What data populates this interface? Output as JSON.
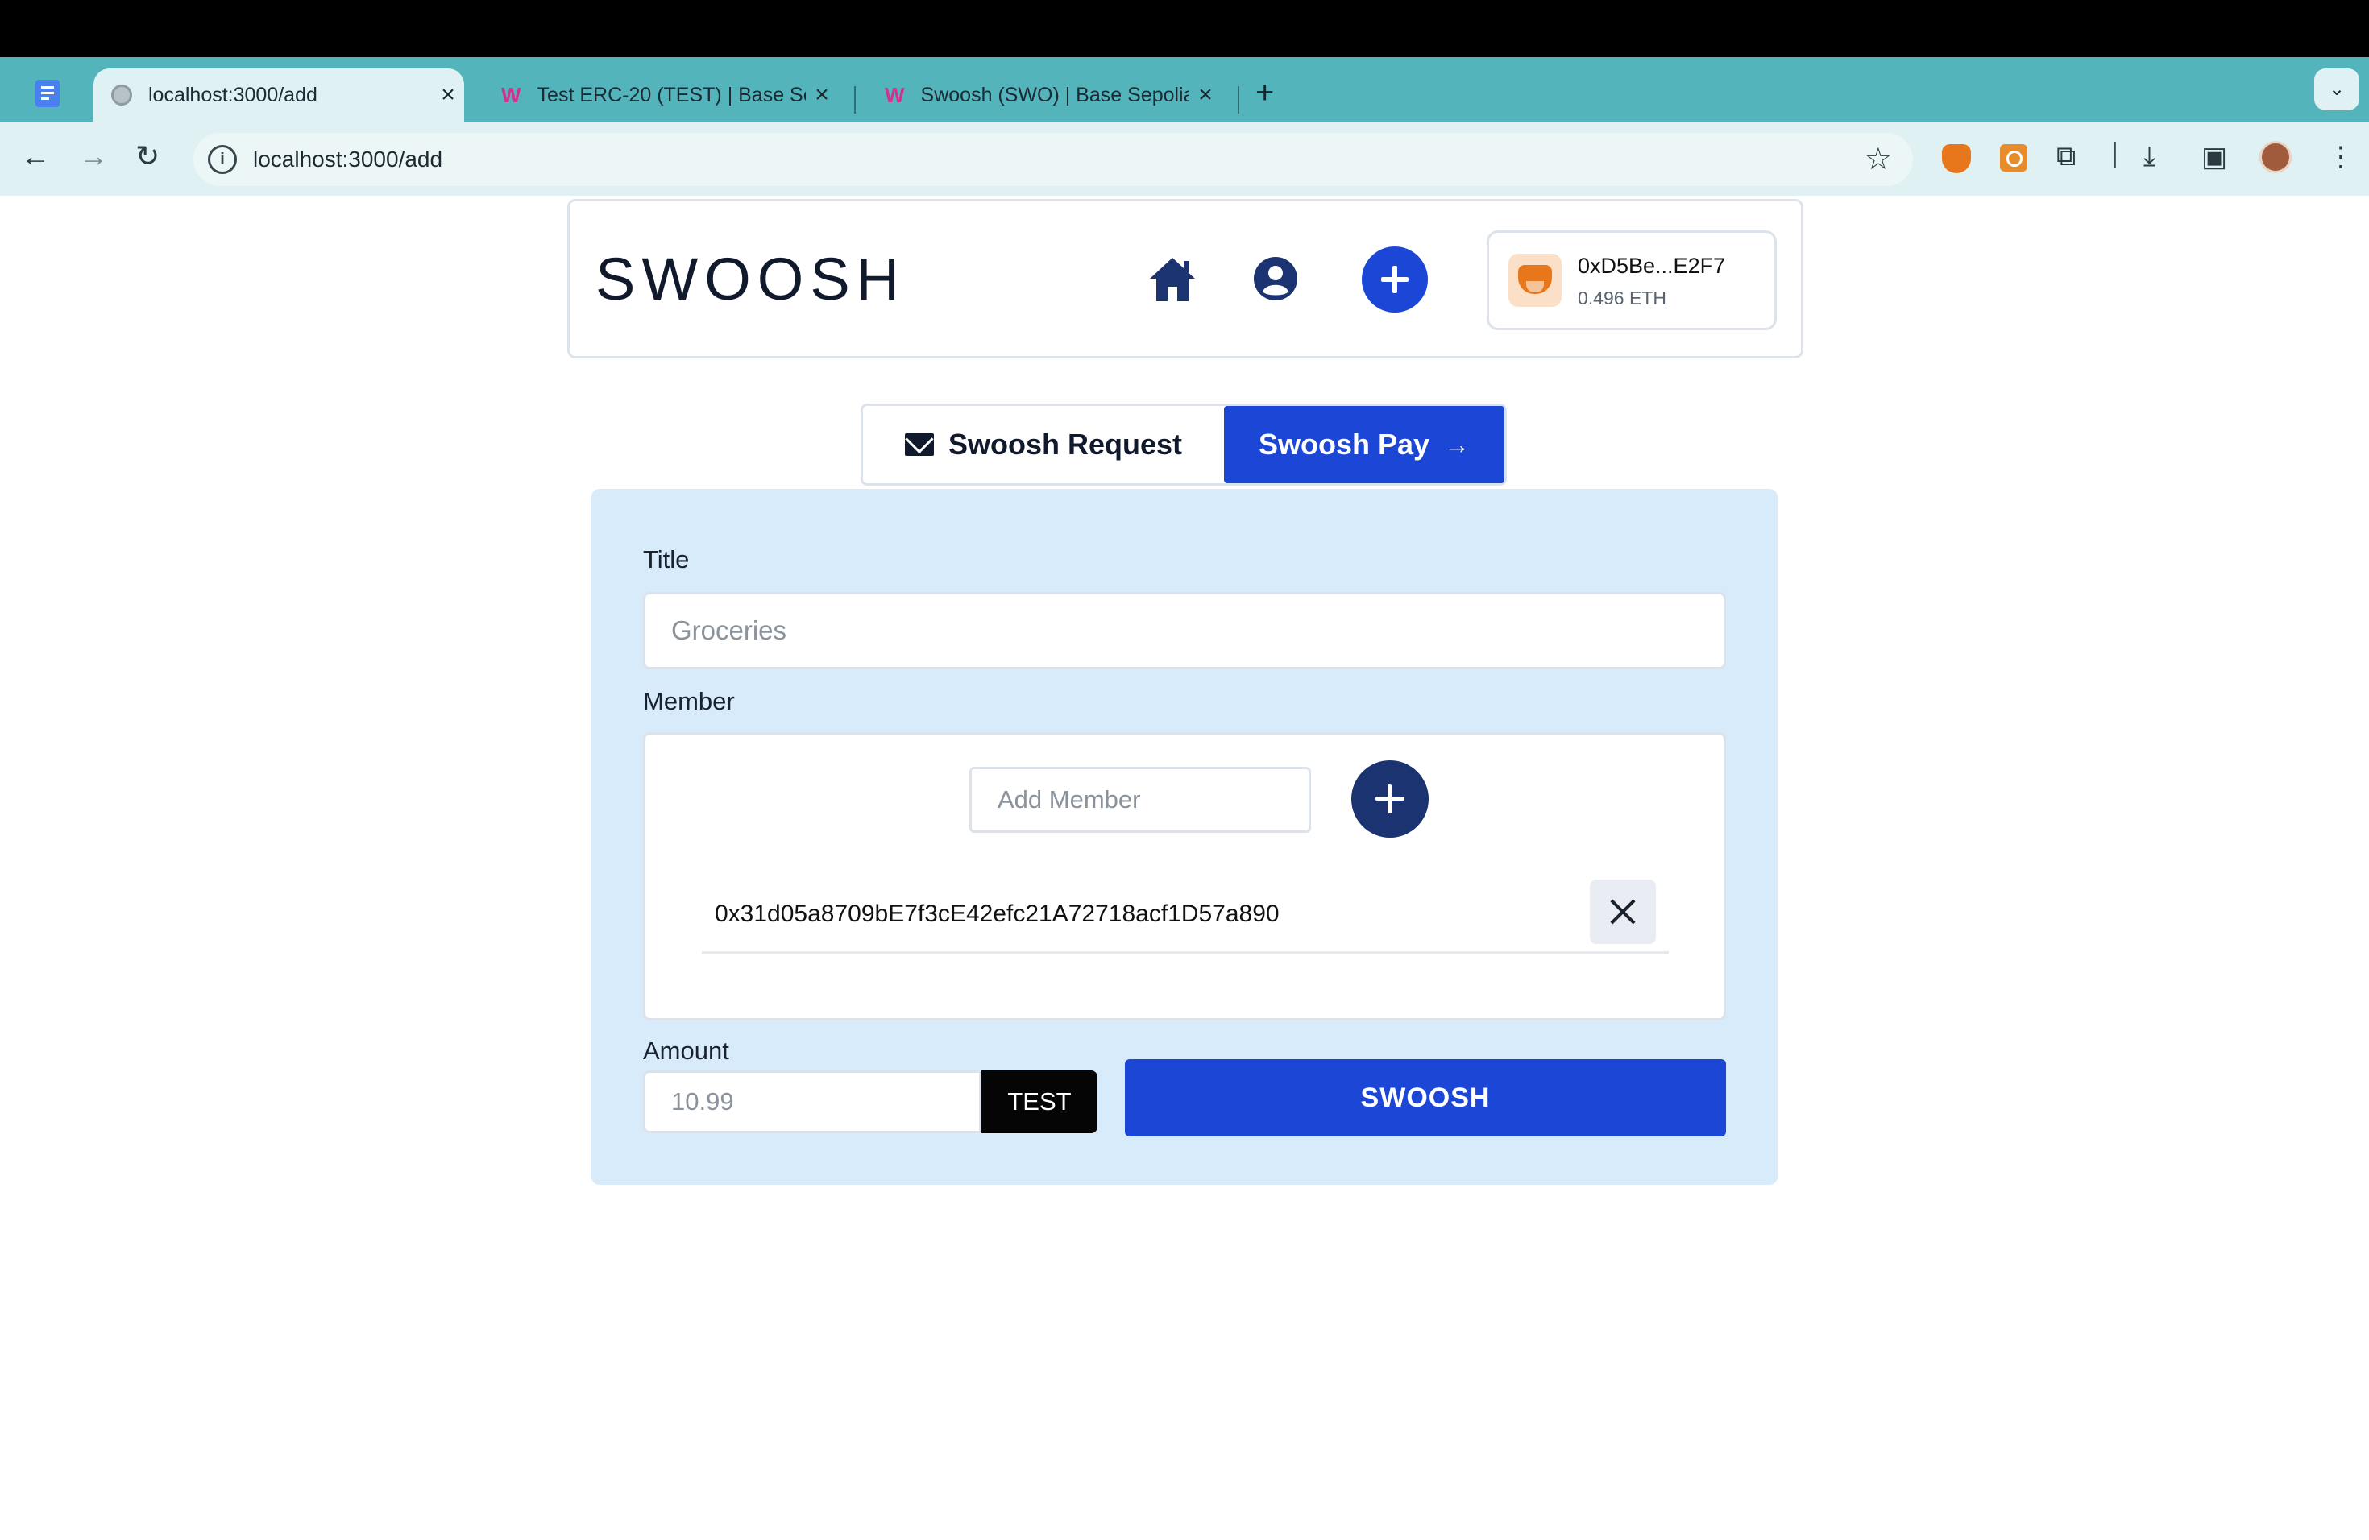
{
  "browser": {
    "tabs": [
      {
        "title": "localhost:3000/add",
        "active": true
      },
      {
        "title": "Test ERC-20 (TEST) | Base Se",
        "active": false
      },
      {
        "title": "Swoosh (SWO) | Base Sepolia",
        "active": false
      }
    ],
    "new_tab": "+",
    "tab_menu": "⌄",
    "url": "localhost:3000/add",
    "nav": {
      "back": "←",
      "forward": "→",
      "reload": "↻",
      "star": "☆"
    },
    "toolbar_icons": [
      "metamask-icon",
      "extension-o-icon",
      "puzzle-icon",
      "download-icon",
      "sidebar-icon",
      "profile-avatar",
      "more-menu-icon"
    ]
  },
  "header": {
    "logo": "SWOOSH",
    "wallet": {
      "address": "0xD5Be...E2F7",
      "balance": "0.496 ETH"
    }
  },
  "mode_tabs": {
    "request_label": "Swoosh Request",
    "pay_label": "Swoosh Pay",
    "pay_arrow": "→",
    "active": "Swoosh Pay"
  },
  "form": {
    "title_label": "Title",
    "title_placeholder": "Groceries",
    "member_label": "Member",
    "member_placeholder": "Add Member",
    "members": [
      "0x31d05a8709bE7f3cE42efc21A72718acf1D57a890"
    ],
    "amount_label": "Amount",
    "amount_placeholder": "10.99",
    "token": "TEST",
    "submit_label": "SWOOSH"
  },
  "colors": {
    "accent": "#1b46d6",
    "tabstrip": "#54b4bc",
    "panel": "#d7ebfa",
    "dark_button": "#1c3371"
  }
}
